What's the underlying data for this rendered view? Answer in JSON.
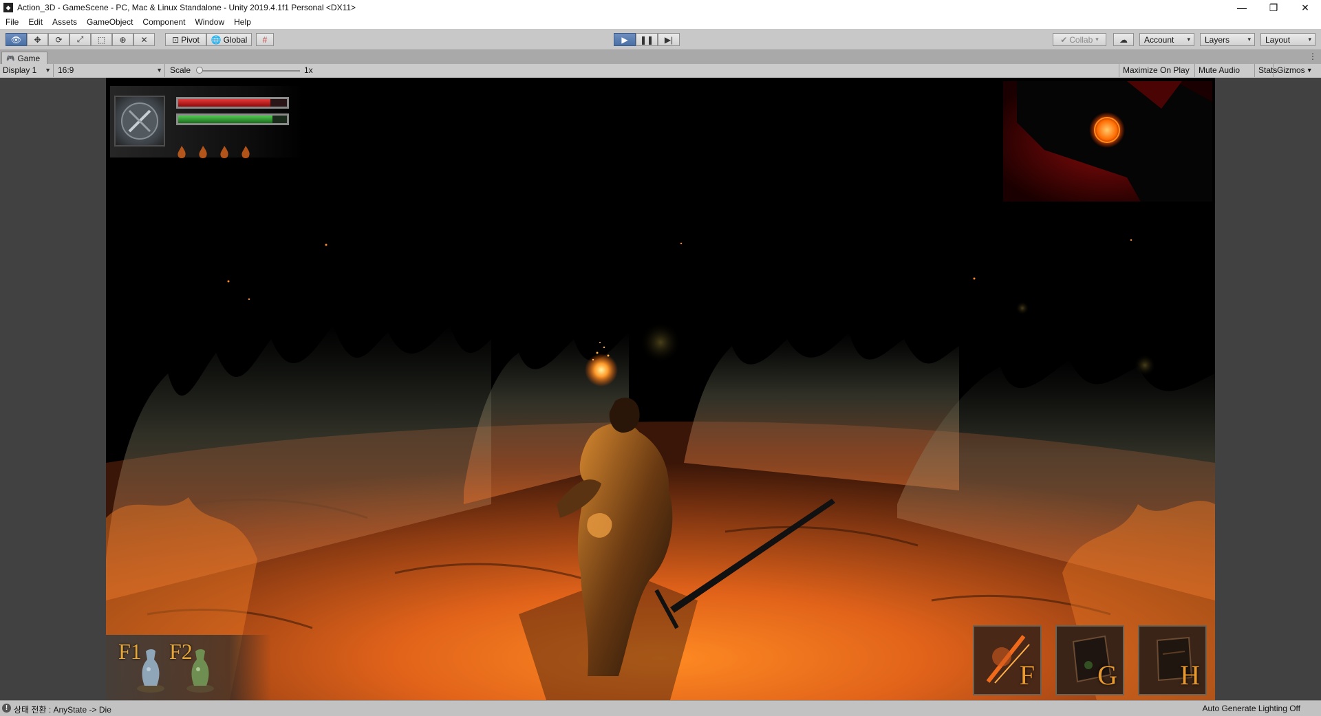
{
  "window": {
    "title": "Action_3D - GameScene - PC, Mac & Linux Standalone - Unity 2019.4.1f1 Personal <DX11>",
    "minimize_glyph": "—",
    "restore_glyph": "❐",
    "close_glyph": "✕"
  },
  "menu": [
    "File",
    "Edit",
    "Assets",
    "GameObject",
    "Component",
    "Window",
    "Help"
  ],
  "toolbar": {
    "pivot_label": "Pivot",
    "global_label": "Global",
    "collab_label": "Collab",
    "account_label": "Account",
    "layers_label": "Layers",
    "layout_label": "Layout",
    "play_state": "playing"
  },
  "game_tab": {
    "label": "Game",
    "display": "Display 1",
    "aspect": "16:9",
    "scale_label": "Scale",
    "scale_value": "1x",
    "maximize_label": "Maximize On Play",
    "mute_label": "Mute Audio",
    "stats_label": "Stats",
    "gizmos_label": "Gizmos"
  },
  "hud": {
    "health_fraction": 0.85,
    "stamina_fraction": 0.87,
    "flame_slots": 4,
    "potions": [
      {
        "key": "F1",
        "color": "#8fa6b8"
      },
      {
        "key": "F2",
        "color": "#6f8f52"
      }
    ],
    "skills": [
      {
        "key": "F",
        "tint": "#d0581c"
      },
      {
        "key": "G",
        "tint": "#3a2418"
      },
      {
        "key": "H",
        "tint": "#3a2418"
      }
    ]
  },
  "status": {
    "message": "상태 전환 : AnyState -> Die",
    "lighting": "Auto Generate Lighting Off"
  },
  "colors": {
    "accent": "#4a6fa5",
    "fire": "#e86a1c",
    "health": "#c41e1e",
    "stamina": "#2e9a2e"
  }
}
